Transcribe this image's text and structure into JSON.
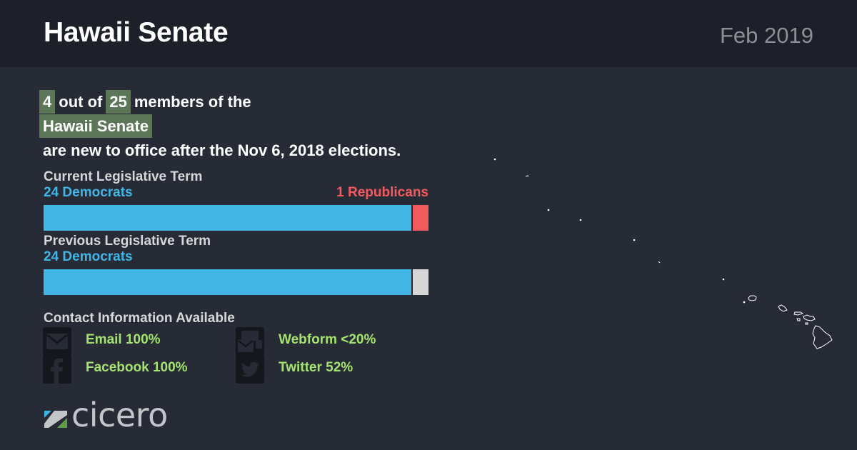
{
  "header": {
    "title": "Hawaii Senate",
    "date": "Feb 2019"
  },
  "headline": {
    "new_count": "4",
    "out_of_text": "out of",
    "total": "25",
    "members_text": "members of the",
    "body_name": "Hawaii Senate",
    "suffix": "are new to office after the Nov 6, 2018 elections."
  },
  "current_term": {
    "label": "Current Legislative Term",
    "dem_label": "24 Democrats",
    "rep_label": "1 Republicans",
    "dem": 24,
    "rep": 1,
    "total": 25
  },
  "previous_term": {
    "label": "Previous Legislative Term",
    "dem_label": "24 Democrats",
    "dem": 24,
    "other": 1,
    "total": 25
  },
  "contact": {
    "title": "Contact Information Available",
    "items": [
      {
        "icon": "envelope-icon",
        "label": "Email 100%"
      },
      {
        "icon": "webform-icon",
        "label": "Webform <20%"
      },
      {
        "icon": "facebook-icon",
        "label": "Facebook 100%"
      },
      {
        "icon": "twitter-icon",
        "label": "Twitter 52%"
      }
    ]
  },
  "brand": {
    "name": "cicero"
  },
  "colors": {
    "democrat": "#41b6e6",
    "republican": "#f25a5e",
    "other": "#d6d6d6",
    "highlight": "#5c7757",
    "contact_text": "#a5e370"
  }
}
